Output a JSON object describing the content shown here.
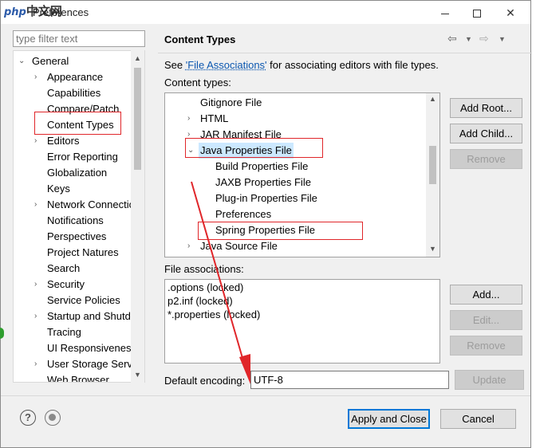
{
  "window": {
    "title": "Preferences",
    "logo_php": "php",
    "logo_cn": "中文网"
  },
  "filter": {
    "placeholder": "type filter text"
  },
  "tree": {
    "items": [
      {
        "label": "General",
        "expanded": true
      },
      {
        "label": "Appearance",
        "expandable": true
      },
      {
        "label": "Capabilities"
      },
      {
        "label": "Compare/Patch"
      },
      {
        "label": "Content Types",
        "selected": true
      },
      {
        "label": "Editors",
        "expandable": true
      },
      {
        "label": "Error Reporting"
      },
      {
        "label": "Globalization"
      },
      {
        "label": "Keys"
      },
      {
        "label": "Network Connections",
        "expandable": true
      },
      {
        "label": "Notifications"
      },
      {
        "label": "Perspectives"
      },
      {
        "label": "Project Natures"
      },
      {
        "label": "Search"
      },
      {
        "label": "Security",
        "expandable": true
      },
      {
        "label": "Service Policies"
      },
      {
        "label": "Startup and Shutdown",
        "expandable": true
      },
      {
        "label": "Tracing"
      },
      {
        "label": "UI Responsiveness"
      },
      {
        "label": "User Storage Service",
        "expandable": true
      },
      {
        "label": "Web Browser"
      }
    ]
  },
  "panel": {
    "title": "Content Types",
    "see_prefix": "See ",
    "see_link": "'File Associations'",
    "see_suffix": " for associating editors with file types.",
    "content_types_label": "Content types:",
    "content_types": [
      {
        "label": "Gitignore File"
      },
      {
        "label": "HTML",
        "expandable": true
      },
      {
        "label": "JAR Manifest File",
        "expandable": true
      },
      {
        "label": "Java Properties File",
        "expanded": true,
        "selected": true
      },
      {
        "label": "Build Properties File"
      },
      {
        "label": "JAXB Properties File"
      },
      {
        "label": "Plug-in Properties File"
      },
      {
        "label": "Preferences"
      },
      {
        "label": "Spring Properties File"
      },
      {
        "label": "Java Source File",
        "expandable": true
      }
    ],
    "buttons_ct": {
      "add_root": "Add Root...",
      "add_child": "Add Child...",
      "remove": "Remove"
    },
    "file_assoc_label": "File associations:",
    "file_associations": [
      ".options (locked)",
      "p2.inf (locked)",
      "*.properties (locked)"
    ],
    "buttons_fa": {
      "add": "Add...",
      "edit": "Edit...",
      "remove": "Remove"
    },
    "encoding_label": "Default encoding:",
    "encoding_value": "UTF-8",
    "update": "Update"
  },
  "footer": {
    "apply_close": "Apply and Close",
    "cancel": "Cancel"
  }
}
